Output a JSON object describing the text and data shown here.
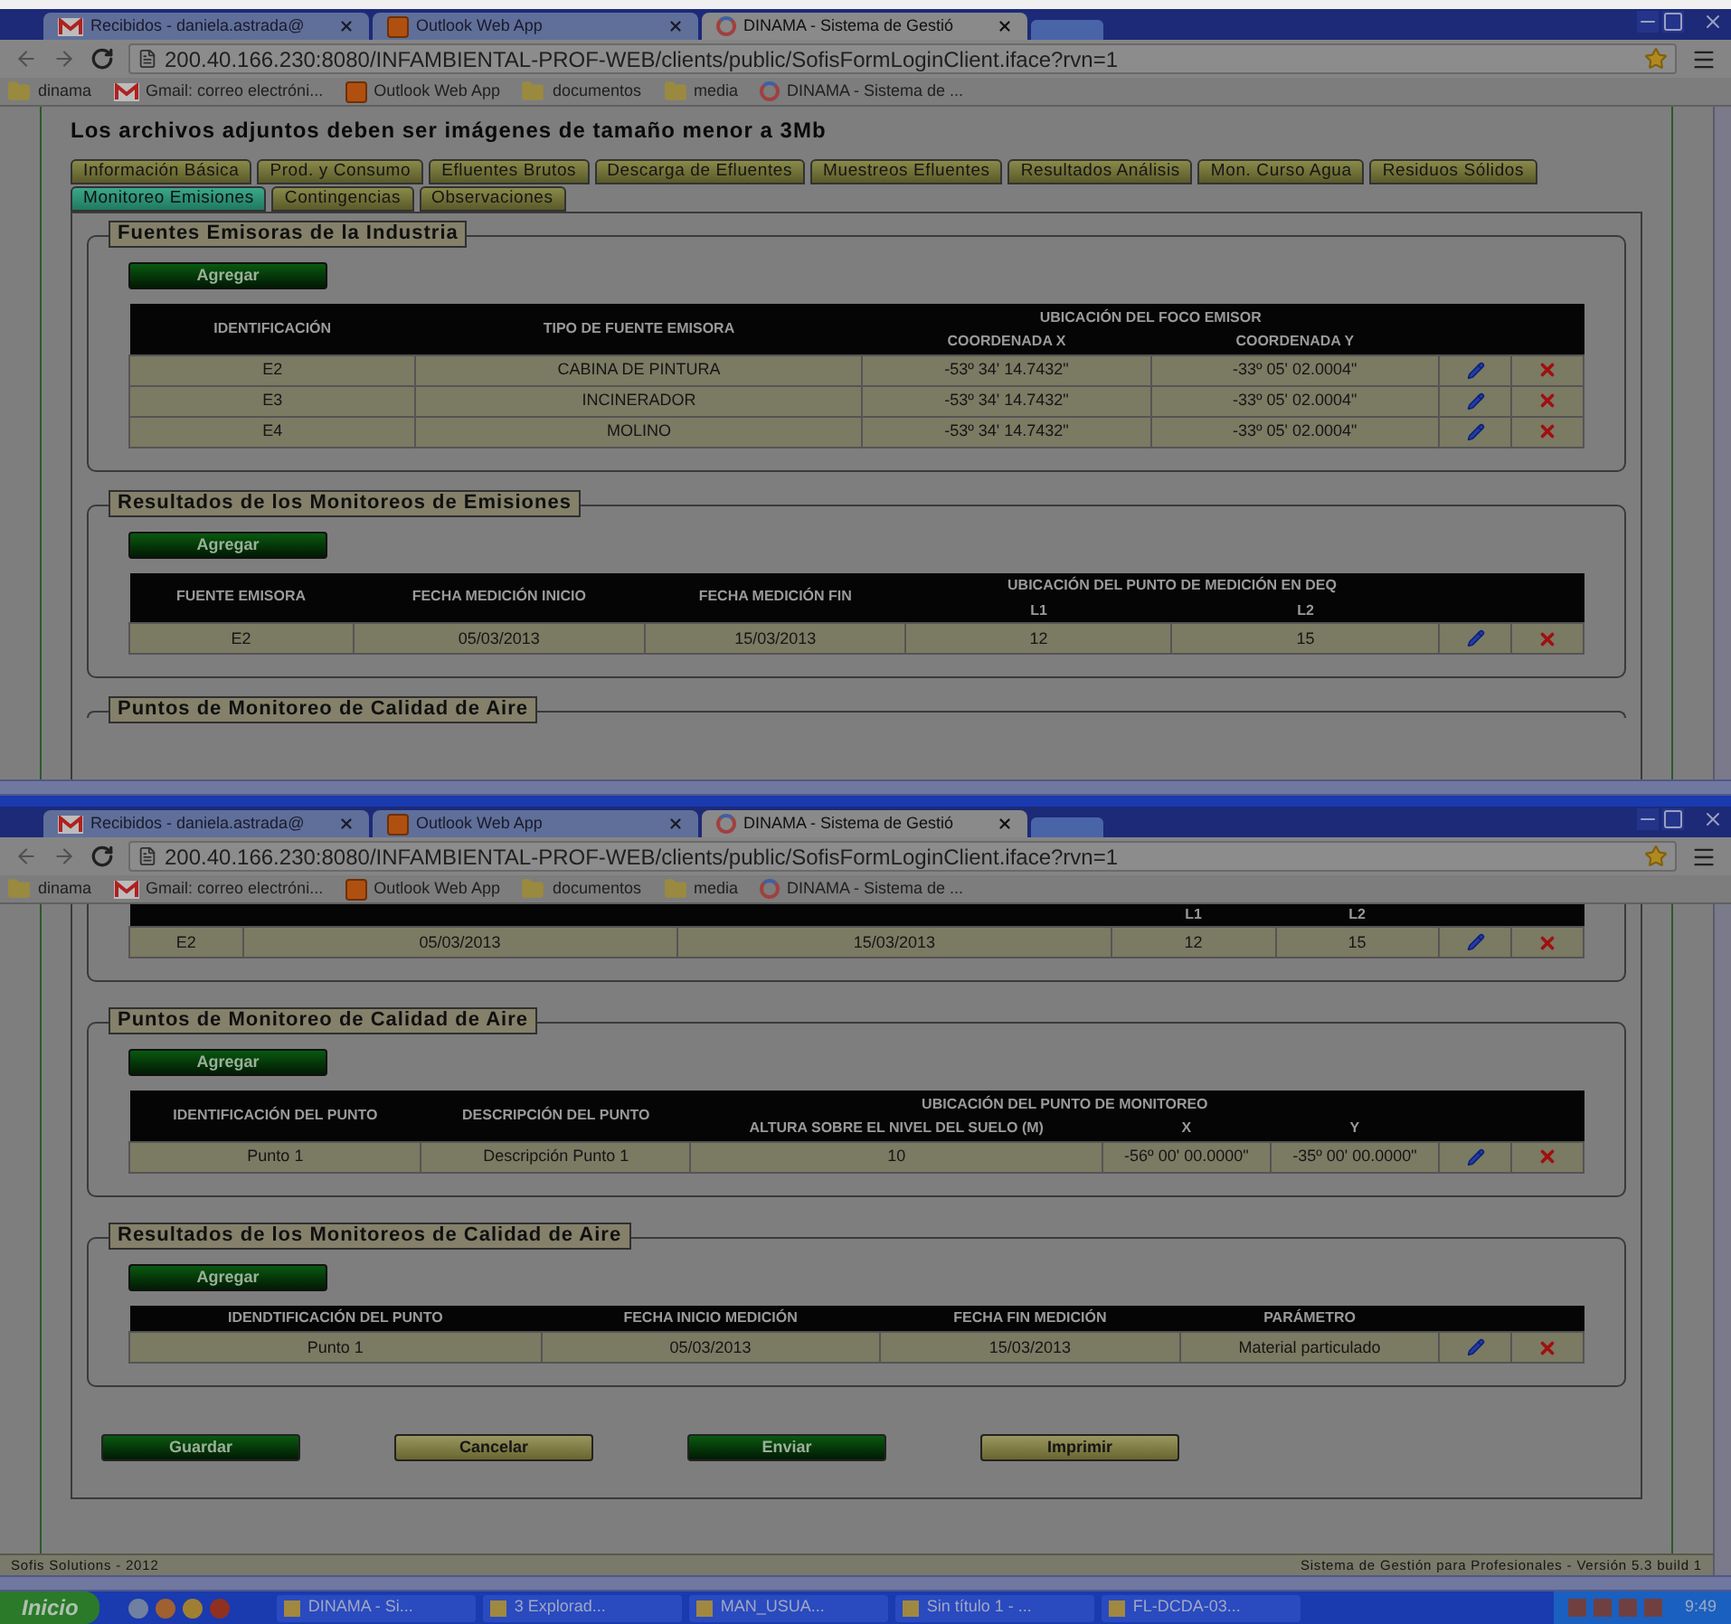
{
  "windows": [
    {
      "browser": {
        "tabs": [
          {
            "label": "Recibidos - daniela.astrada@",
            "selected": false
          },
          {
            "label": "Outlook Web App",
            "selected": false
          },
          {
            "label": "DINAMA - Sistema de Gestió",
            "selected": true
          }
        ],
        "url": "200.40.166.230:8080/INFAMBIENTAL-PROF-WEB/clients/public/SofisFormLoginClient.iface?rvn=1",
        "bookmarks": [
          "dinama",
          "Gmail: correo electróni...",
          "Outlook Web App",
          "documentos",
          "media",
          "DINAMA - Sistema de ..."
        ]
      },
      "notice": "Los archivos adjuntos deben ser imágenes de tamaño menor a 3Mb",
      "form_tabs": [
        {
          "label": "Información Básica",
          "selected": false
        },
        {
          "label": "Prod. y Consumo",
          "selected": false
        },
        {
          "label": "Efluentes Brutos",
          "selected": false
        },
        {
          "label": "Descarga de Efluentes",
          "selected": false
        },
        {
          "label": "Muestreos Efluentes",
          "selected": false
        },
        {
          "label": "Resultados Análisis",
          "selected": false
        },
        {
          "label": "Mon. Curso Agua",
          "selected": false
        },
        {
          "label": "Residuos Sólidos",
          "selected": false
        },
        {
          "label": "Monitoreo Emisiones",
          "selected": true
        },
        {
          "label": "Contingencias",
          "selected": false
        },
        {
          "label": "Observaciones",
          "selected": false
        }
      ],
      "sections": [
        {
          "title": "Fuentes Emisoras de la Industria",
          "add_button": "Agregar",
          "table": {
            "columns": [
              "IDENTIFICACIÓN",
              "TIPO DE FUENTE EMISORA"
            ],
            "group": {
              "label": "UBICACIÓN DEL FOCO EMISOR",
              "columns": [
                "COORDENADA X",
                "COORDENADA Y"
              ]
            },
            "rows": [
              [
                "E2",
                "CABINA DE PINTURA",
                "-53º 34' 14.7432\"",
                "-33º 05' 02.0004\""
              ],
              [
                "E3",
                "INCINERADOR",
                "-53º 34' 14.7432\"",
                "-33º 05' 02.0004\""
              ],
              [
                "E4",
                "MOLINO",
                "-53º 34' 14.7432\"",
                "-33º 05' 02.0004\""
              ]
            ]
          }
        },
        {
          "title": "Resultados de los Monitoreos de Emisiones",
          "add_button": "Agregar",
          "table": {
            "columns": [
              "FUENTE EMISORA",
              "FECHA MEDICIÓN INICIO",
              "FECHA MEDICIÓN FIN"
            ],
            "group": {
              "label": "UBICACIÓN DEL PUNTO DE MEDICIÓN EN DEQ",
              "columns": [
                "L1",
                "L2"
              ]
            },
            "rows": [
              [
                "E2",
                "05/03/2013",
                "15/03/2013",
                "12",
                "15"
              ]
            ]
          }
        },
        {
          "title": "Puntos de Monitoreo de Calidad de Aire"
        }
      ]
    },
    {
      "browser": {
        "tabs": [
          {
            "label": "Recibidos - daniela.astrada@",
            "selected": false
          },
          {
            "label": "Outlook Web App",
            "selected": false
          },
          {
            "label": "DINAMA - Sistema de Gestió",
            "selected": true
          }
        ],
        "url": "200.40.166.230:8080/INFAMBIENTAL-PROF-WEB/clients/public/SofisFormLoginClient.iface?rvn=1",
        "bookmarks": [
          "dinama",
          "Gmail: correo electróni...",
          "Outlook Web App",
          "documentos",
          "media",
          "DINAMA - Sistema de ..."
        ]
      },
      "table_tail": {
        "group_columns": [
          "L1",
          "L2"
        ],
        "rows": [
          [
            "E2",
            "05/03/2013",
            "15/03/2013",
            "12",
            "15"
          ]
        ]
      },
      "sections": [
        {
          "title": "Puntos de Monitoreo de Calidad de Aire",
          "add_button": "Agregar",
          "table": {
            "columns": [
              "IDENTIFICACIÓN DEL PUNTO",
              "DESCRIPCIÓN DEL PUNTO"
            ],
            "group": {
              "label": "UBICACIÓN DEL PUNTO DE MONITOREO",
              "columns": [
                "ALTURA SOBRE EL NIVEL DEL SUELO (M)",
                "X",
                "Y"
              ]
            },
            "rows": [
              [
                "Punto 1",
                "Descripción Punto 1",
                "10",
                "-56º 00' 00.0000\"",
                "-35º 00' 00.0000\""
              ]
            ]
          }
        },
        {
          "title": "Resultados de los Monitoreos de Calidad de Aire",
          "add_button": "Agregar",
          "table": {
            "columns": [
              "IDENDTIFICACIÓN DEL PUNTO",
              "FECHA INICIO MEDICIÓN",
              "FECHA FIN MEDICIÓN",
              "PARÁMETRO"
            ],
            "rows": [
              [
                "Punto 1",
                "05/03/2013",
                "15/03/2013",
                "Material particulado"
              ]
            ]
          }
        }
      ],
      "buttons": [
        {
          "label": "Guardar",
          "kind": "primary"
        },
        {
          "label": "Cancelar",
          "kind": "secondary"
        },
        {
          "label": "Enviar",
          "kind": "primary"
        },
        {
          "label": "Imprimir",
          "kind": "secondary"
        }
      ],
      "footer": {
        "left": "Sofis Solutions - 2012",
        "right": "Sistema de Gestión para Profesionales - Versión 5.3 build 1"
      }
    }
  ],
  "taskbar": {
    "start": "Inicio",
    "items": [
      "DINAMA - Si...",
      "3 Explorad...",
      "MAN_USUA...",
      "Sin título 1 - ...",
      "FL-DCDA-03..."
    ],
    "clock": "9:49"
  }
}
